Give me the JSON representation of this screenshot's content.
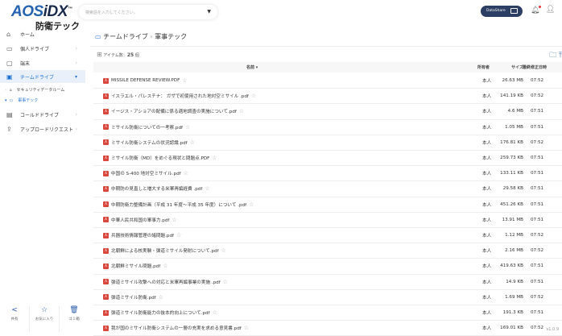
{
  "header": {
    "logo": "AOS iDX",
    "logo_tm": "TM",
    "subtitle": "防衛テック",
    "search_placeholder": "検索語を入力してください。",
    "datashare": "DataShare"
  },
  "sidebar": {
    "items": [
      {
        "label": "ホーム",
        "icon": "⌂"
      },
      {
        "label": "個人ドライブ",
        "icon": "▭"
      },
      {
        "label": "端末",
        "icon": "▢"
      },
      {
        "label": "チームドライブ",
        "icon": "▣"
      },
      {
        "label": "コールドドライブ",
        "icon": "▤"
      },
      {
        "label": "アップロードリクエスト",
        "icon": "⇪"
      }
    ],
    "sub": [
      {
        "label": "セキュリティデータルーム"
      },
      {
        "label": "軍事テック"
      }
    ],
    "bottom": [
      {
        "label": "共有",
        "icon": "<"
      },
      {
        "label": "お気に入り",
        "icon": "☆"
      },
      {
        "label": "ゴミ箱",
        "icon": "🗑"
      }
    ]
  },
  "main": {
    "breadcrumb": [
      "チームドライブ",
      "軍事テック"
    ],
    "count_label": "アイテム数：",
    "count": "25",
    "count_unit": "個",
    "columns": {
      "name": "名前 ▾",
      "size": "サイズ",
      "owner": "所有者",
      "modified": "最終修正日時"
    },
    "rows": [
      {
        "name": "MISSILE DEFENSE REVIEW.PDF",
        "size": "26.63 MB",
        "owner": "本人",
        "modified": "07:52"
      },
      {
        "name": "イスラエル・パレスチナ： ガザで初使用された地対空ミサイル .pdf",
        "size": "141.19 KB",
        "owner": "本人",
        "modified": "07:52"
      },
      {
        "name": "イージス・アショアの配備に係る適地調査の実施について.pdf",
        "size": "4.6 MB",
        "owner": "本人",
        "modified": "07:51"
      },
      {
        "name": "ミサイル防衛についての一考察.pdf",
        "size": "1.05 MB",
        "owner": "本人",
        "modified": "07:51"
      },
      {
        "name": "ミサイル防衛システムの状況認識.pdf",
        "size": "176.81 KB",
        "owner": "本人",
        "modified": "07:52"
      },
      {
        "name": "ミサイル防衛（MD）をめぐる現状と問題点.PDF",
        "size": "259.73 KB",
        "owner": "本人",
        "modified": "07:51"
      },
      {
        "name": "中国の S-400 地対空ミサイル.pdf",
        "size": "133.11 KB",
        "owner": "本人",
        "modified": "07:51"
      },
      {
        "name": "中期防の見直しと増大する米軍再編経費 .pdf",
        "size": "29.58 KB",
        "owner": "本人",
        "modified": "07:51"
      },
      {
        "name": "中期防衛力整備計画（平成 31 年度〜平成 35 年度）について .pdf",
        "size": "451.26 KB",
        "owner": "本人",
        "modified": "07:51"
      },
      {
        "name": "中華人民共和国の軍事力.pdf",
        "size": "13.91 MB",
        "owner": "本人",
        "modified": "07:51"
      },
      {
        "name": "兵器技術情報管理の諸問題.pdf",
        "size": "1.12 MB",
        "owner": "本人",
        "modified": "07:52"
      },
      {
        "name": "北朝鮮による核実験・弾道ミサイル発射について.pdf",
        "size": "2.16 MB",
        "owner": "本人",
        "modified": "07:52"
      },
      {
        "name": "北朝鮮ミサイル問題.pdf",
        "size": "419.63 KB",
        "owner": "本人",
        "modified": "07:51"
      },
      {
        "name": "弾道ミサイル攻撃への対応と米軍再編事業の実施 .pdf",
        "size": "14.9 KB",
        "owner": "本人",
        "modified": "07:51"
      },
      {
        "name": "弾道ミサイル防衛.pdf",
        "size": "1.69 MB",
        "owner": "本人",
        "modified": "07:52"
      },
      {
        "name": "弾道ミサイル防衛能力の抜本的向上について.pdf",
        "size": "191.3 KB",
        "owner": "本人",
        "modified": "07:51"
      },
      {
        "name": "我が国のミサイル防衛システムの一層の充実を求める意見書.pdf",
        "size": "169.01 KB",
        "owner": "本人",
        "modified": "07:52"
      }
    ]
  },
  "version": "v1.0.9"
}
